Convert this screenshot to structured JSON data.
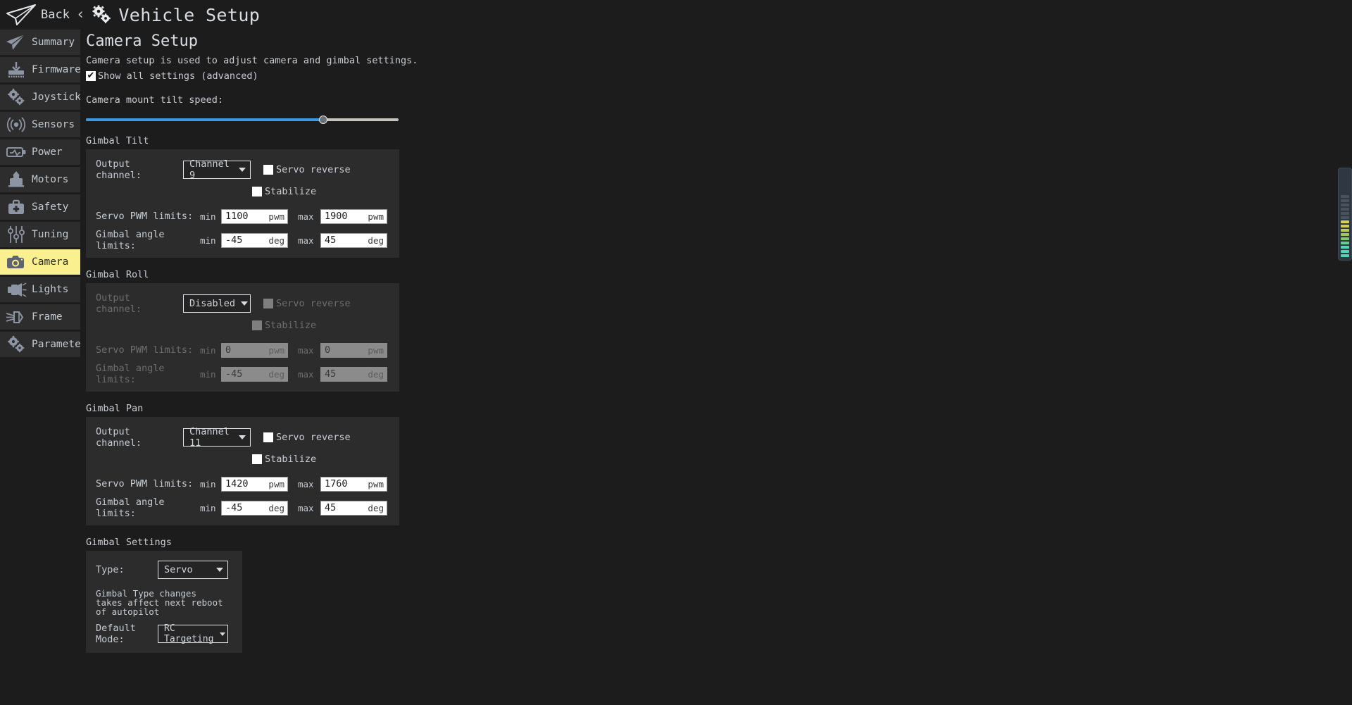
{
  "header": {
    "plane_icon": "paper-plane-icon",
    "back_label": "Back",
    "back_chevron": "‹",
    "gears_icon": "gears-icon",
    "title": "Vehicle Setup"
  },
  "sidebar": {
    "items": [
      {
        "label": "Summary",
        "icon": "paper-plane-icon",
        "selected": false
      },
      {
        "label": "Firmware",
        "icon": "firmware-download-icon",
        "selected": false
      },
      {
        "label": "Joystick",
        "icon": "gears-icon",
        "selected": false
      },
      {
        "label": "Sensors",
        "icon": "sensors-waves-icon",
        "selected": false
      },
      {
        "label": "Power",
        "icon": "battery-icon",
        "selected": false
      },
      {
        "label": "Motors",
        "icon": "motor-icon",
        "selected": false
      },
      {
        "label": "Safety",
        "icon": "first-aid-kit-icon",
        "selected": false
      },
      {
        "label": "Tuning",
        "icon": "sliders-icon",
        "selected": false
      },
      {
        "label": "Camera",
        "icon": "camera-icon",
        "selected": true
      },
      {
        "label": "Lights",
        "icon": "light-icon",
        "selected": false
      },
      {
        "label": "Frame",
        "icon": "frame-icon",
        "selected": false
      },
      {
        "label": "Parameters",
        "icon": "gears-icon",
        "selected": false
      }
    ]
  },
  "page": {
    "title": "Camera Setup",
    "description": "Camera setup is used to adjust camera and gimbal settings.",
    "show_all_settings": {
      "label": "Show all settings (advanced)",
      "checked": true
    },
    "tilt_speed": {
      "label": "Camera mount tilt speed:",
      "value_pct": 76
    }
  },
  "colors": {
    "accent_selected": "#fbf08f",
    "slider_fill": "#3d9ae0",
    "slider_groove": "#c9c5bc",
    "panel_bg": "#2c2c2c",
    "page_bg": "#1c1c1c"
  },
  "labels": {
    "output_channel": "Output channel:",
    "servo_reverse": "Servo reverse",
    "stabilize": "Stabilize",
    "servo_pwm_limits": "Servo PWM limits:",
    "gimbal_angle_limits": "Gimbal angle limits:",
    "min": "min",
    "max": "max",
    "unit_pwm": "pwm",
    "unit_deg": "deg"
  },
  "gimbal_tilt": {
    "title": "Gimbal Tilt",
    "enabled": true,
    "channel": "Channel 9",
    "servo_reverse": false,
    "stabilize": false,
    "pwm_min": "1100",
    "pwm_max": "1900",
    "angle_min": "-45",
    "angle_max": "45"
  },
  "gimbal_roll": {
    "title": "Gimbal Roll",
    "enabled": false,
    "channel": "Disabled",
    "servo_reverse": false,
    "stabilize": false,
    "pwm_min": "0",
    "pwm_max": "0",
    "angle_min": "-45",
    "angle_max": "45"
  },
  "gimbal_pan": {
    "title": "Gimbal Pan",
    "enabled": true,
    "channel": "Channel 11",
    "servo_reverse": false,
    "stabilize": false,
    "pwm_min": "1420",
    "pwm_max": "1760",
    "angle_min": "-45",
    "angle_max": "45"
  },
  "gimbal_settings": {
    "title": "Gimbal Settings",
    "type_label": "Type:",
    "type_value": "Servo",
    "note": "Gimbal Type changes takes affect next reboot of autopilot",
    "default_mode_label": "Default Mode:",
    "default_mode_value": "RC Targeting"
  },
  "led_meter": {
    "name": "vertical-led-meter",
    "segments": [
      "#4fd6b8",
      "#4fd6b8",
      "#4fd6b8",
      "#62cf8e",
      "#7ec96a",
      "#9cc75c",
      "#bcc954",
      "#d2cb53",
      "#d8cf55",
      "#4a525c",
      "#4a525c",
      "#4a525c",
      "#4a525c",
      "#4a525c",
      "#4a525c"
    ]
  }
}
